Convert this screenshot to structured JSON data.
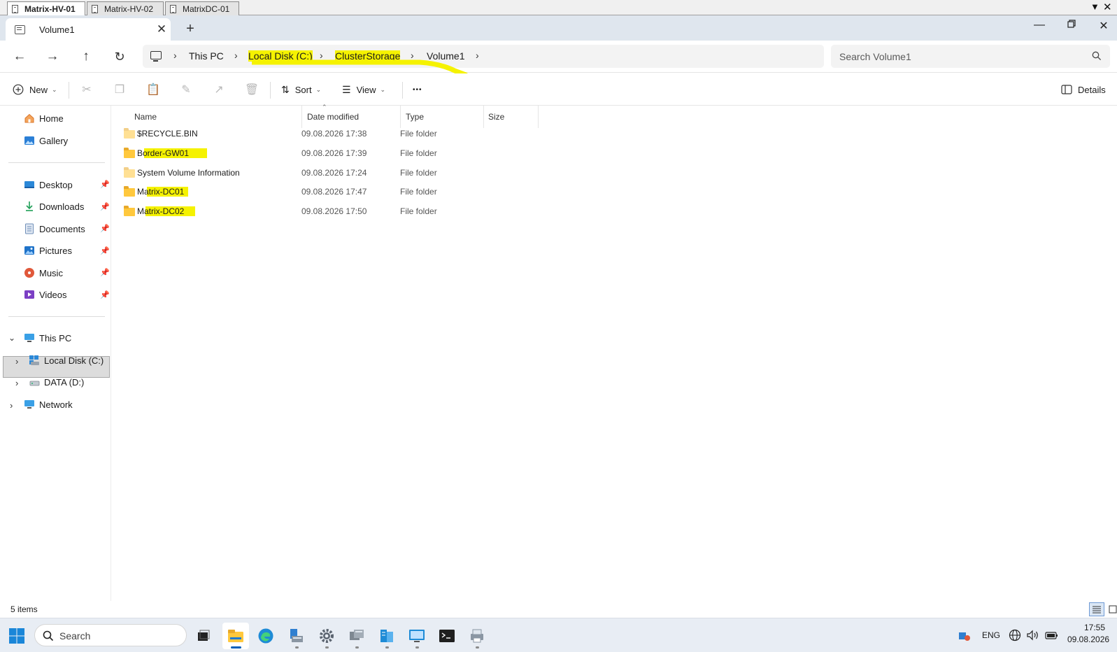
{
  "rdp": {
    "tabs": [
      {
        "label": "Matrix-HV-01",
        "active": true
      },
      {
        "label": "Matrix-HV-02",
        "active": false
      },
      {
        "label": "MatrixDC-01",
        "active": false
      }
    ],
    "dropdown_icon": "triangle-down-icon",
    "close_icon": "close-icon"
  },
  "explorer": {
    "tab_title": "Volume1",
    "new_tab_glyph": "+",
    "window_controls": [
      "minimize-icon",
      "restore-icon",
      "close-icon"
    ]
  },
  "address": {
    "crumbs": [
      "This PC",
      "Local Disk (C:)",
      "ClusterStorage",
      "Volume1"
    ],
    "highlighted_crumbs": [
      "Local Disk (C:)",
      "ClusterStorage"
    ],
    "search_placeholder": "Search Volume1"
  },
  "commands": {
    "new_label": "New",
    "sort_label": "Sort",
    "view_label": "View",
    "more_glyph": "•••",
    "details_label": "Details"
  },
  "sidebar": {
    "quick": [
      {
        "label": "Home",
        "icon": "home-icon"
      },
      {
        "label": "Gallery",
        "icon": "gallery-icon"
      }
    ],
    "pinned": [
      {
        "label": "Desktop",
        "icon": "desktop-icon"
      },
      {
        "label": "Downloads",
        "icon": "downloads-icon"
      },
      {
        "label": "Documents",
        "icon": "documents-icon"
      },
      {
        "label": "Pictures",
        "icon": "pictures-icon"
      },
      {
        "label": "Music",
        "icon": "music-icon"
      },
      {
        "label": "Videos",
        "icon": "videos-icon"
      }
    ],
    "tree": {
      "this_pc": "This PC",
      "local_disk": "Local Disk (C:)",
      "data_drive": "DATA (D:)",
      "network": "Network"
    }
  },
  "columns": [
    "Name",
    "Date modified",
    "Type",
    "Size"
  ],
  "files": [
    {
      "name": "$RECYCLE.BIN",
      "date": "09.08.2026 17:38",
      "type": "File folder",
      "highlighted": false
    },
    {
      "name": "Border-GW01",
      "date": "09.08.2026 17:39",
      "type": "File folder",
      "highlighted": true
    },
    {
      "name": "System Volume Information",
      "date": "09.08.2026 17:24",
      "type": "File folder",
      "highlighted": false
    },
    {
      "name": "Matrix-DC01",
      "date": "09.08.2026 17:47",
      "type": "File folder",
      "highlighted": true
    },
    {
      "name": "Matrix-DC02",
      "date": "09.08.2026 17:50",
      "type": "File folder",
      "highlighted": true
    }
  ],
  "status": {
    "item_count": "5 items"
  },
  "taskbar": {
    "search_label": "Search",
    "apps": [
      "file-explorer-icon",
      "edge-icon",
      "server-manager-icon",
      "settings-icon",
      "hyper-v-manager-icon",
      "failover-cluster-icon",
      "remote-desktop-icon",
      "terminal-icon",
      "printer-icon"
    ],
    "language": "ENG",
    "time": "17:55",
    "date": "09.08.2026"
  },
  "colors": {
    "highlight": "#f5f200",
    "folder": "#ffc83d",
    "accent": "#005fb8"
  }
}
